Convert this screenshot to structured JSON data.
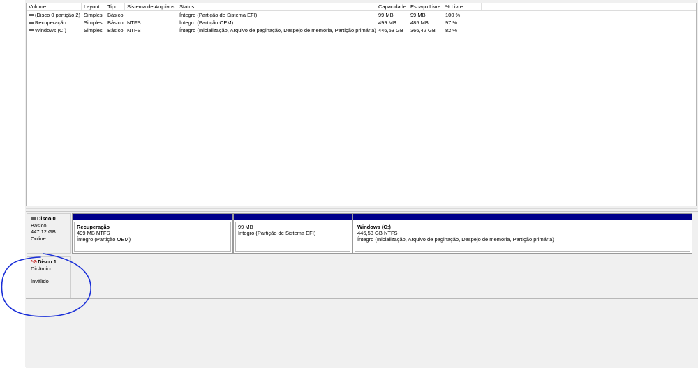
{
  "volume_list": {
    "columns": [
      "Volume",
      "Layout",
      "Tipo",
      "Sistema de Arquivos",
      "Status",
      "Capacidade",
      "Espaço Livre",
      "% Livre"
    ],
    "rows": [
      {
        "volume": "(Disco 0 partição 2)",
        "layout": "Simples",
        "tipo": "Básico",
        "fs": "",
        "status": "Íntegro (Partição de Sistema EFI)",
        "capacidade": "99 MB",
        "livre": "99 MB",
        "pct": "100 %"
      },
      {
        "volume": "Recuperação",
        "layout": "Simples",
        "tipo": "Básico",
        "fs": "NTFS",
        "status": "Íntegro (Partição OEM)",
        "capacidade": "499 MB",
        "livre": "485 MB",
        "pct": "97 %"
      },
      {
        "volume": "Windows (C:)",
        "layout": "Simples",
        "tipo": "Básico",
        "fs": "NTFS",
        "status": "Íntegro (Inicialização, Arquivo de paginação, Despejo de memória, Partição primária)",
        "capacidade": "446,53 GB",
        "livre": "366,42 GB",
        "pct": "82 %"
      }
    ]
  },
  "disk0": {
    "title": "Disco 0",
    "type": "Básico",
    "size": "447,12 GB",
    "state": "Online",
    "partitions": [
      {
        "name": "Recuperação",
        "size": "499 MB NTFS",
        "status": "Íntegro (Partição OEM)"
      },
      {
        "name": "",
        "size": "99 MB",
        "status": "Íntegro (Partição de Sistema EFI)"
      },
      {
        "name": "Windows (C:)",
        "size": "446,53 GB NTFS",
        "status": "Íntegro (Inicialização, Arquivo de paginação, Despejo de memória, Partição primária)"
      }
    ]
  },
  "disk1": {
    "title": "Disco 1",
    "type": "Dinâmico",
    "state": "Inválido"
  },
  "colors": {
    "partition_bar": "#00008b",
    "annotation_circle": "#1a2fd8",
    "error_icon": "#c00000"
  }
}
